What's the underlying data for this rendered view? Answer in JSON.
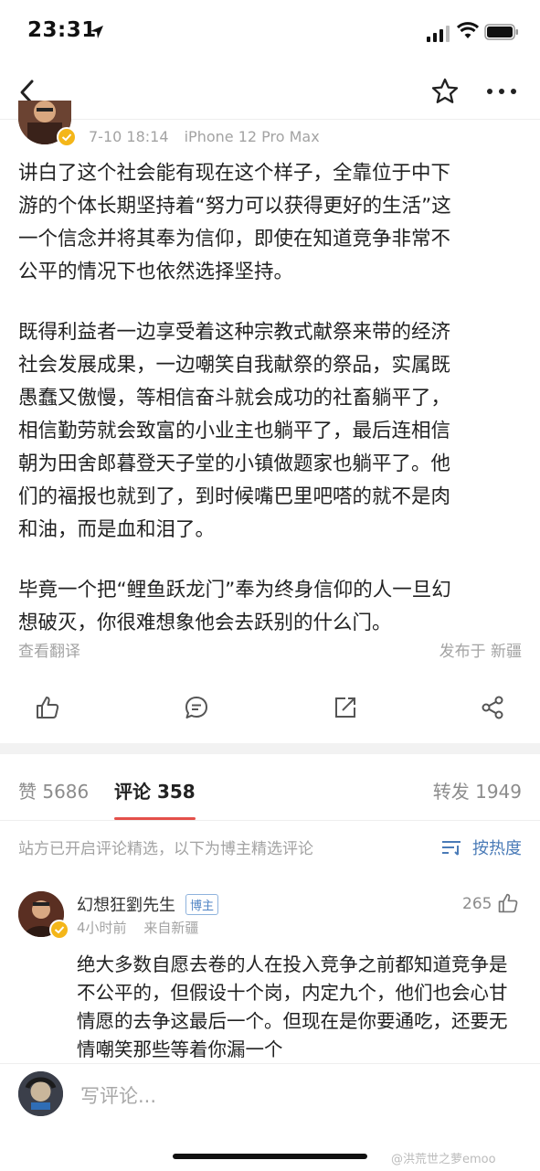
{
  "status_bar": {
    "time": "23:31"
  },
  "post": {
    "date": "7-10 18:14",
    "device": "iPhone 12 Pro Max",
    "paragraphs": [
      "讲白了这个社会能有现在这个样子，全靠位于中下\n游的个体长期坚持着“努力可以获得更好的生活”这\n一个信念并将其奉为信仰，即使在知道竞争非常不\n公平的情况下也依然选择坚持。",
      "既得利益者一边享受着这种宗教式献祭来带的经济\n社会发展成果，一边嘲笑自我献祭的祭品，实属既\n愚蠢又傲慢，等相信奋斗就会成功的社畜躺平了，\n相信勤劳就会致富的小业主也躺平了，最后连相信\n朝为田舍郎暮登天子堂的小镇做题家也躺平了。他\n们的福报也就到了，到时候嘴巴里吧嗒的就不是肉\n和油，而是血和泪了。",
      "毕竟一个把“鲤鱼跃龙门”奉为终身信仰的人一旦幻\n想破灭，你很难想象他会去跃别的什么门。"
    ],
    "translate_label": "查看翻译",
    "location": "发布于 新疆"
  },
  "tabs": {
    "likes": "赞 5686",
    "comments": "评论 358",
    "reposts": "转发 1949"
  },
  "comments_notice": "站方已开启评论精选，以下为博主精选评论",
  "sort_label": "按热度",
  "comment": {
    "author": "幻想狂劉先生",
    "badge": "博主",
    "time": "4小时前",
    "source": "来自新疆",
    "likes": "265",
    "text": "绝大多数自愿去卷的人在投入竞争之前都知道竞争是不公平的，但假设十个岗，内定九个，他们也会心甘情愿的去争这最后一个。但现在是你要通吃，还要无情嘲笑那些等着你漏一个"
  },
  "compose_placeholder": "写评论...",
  "watermark": "@洪荒世之萝emoo"
}
